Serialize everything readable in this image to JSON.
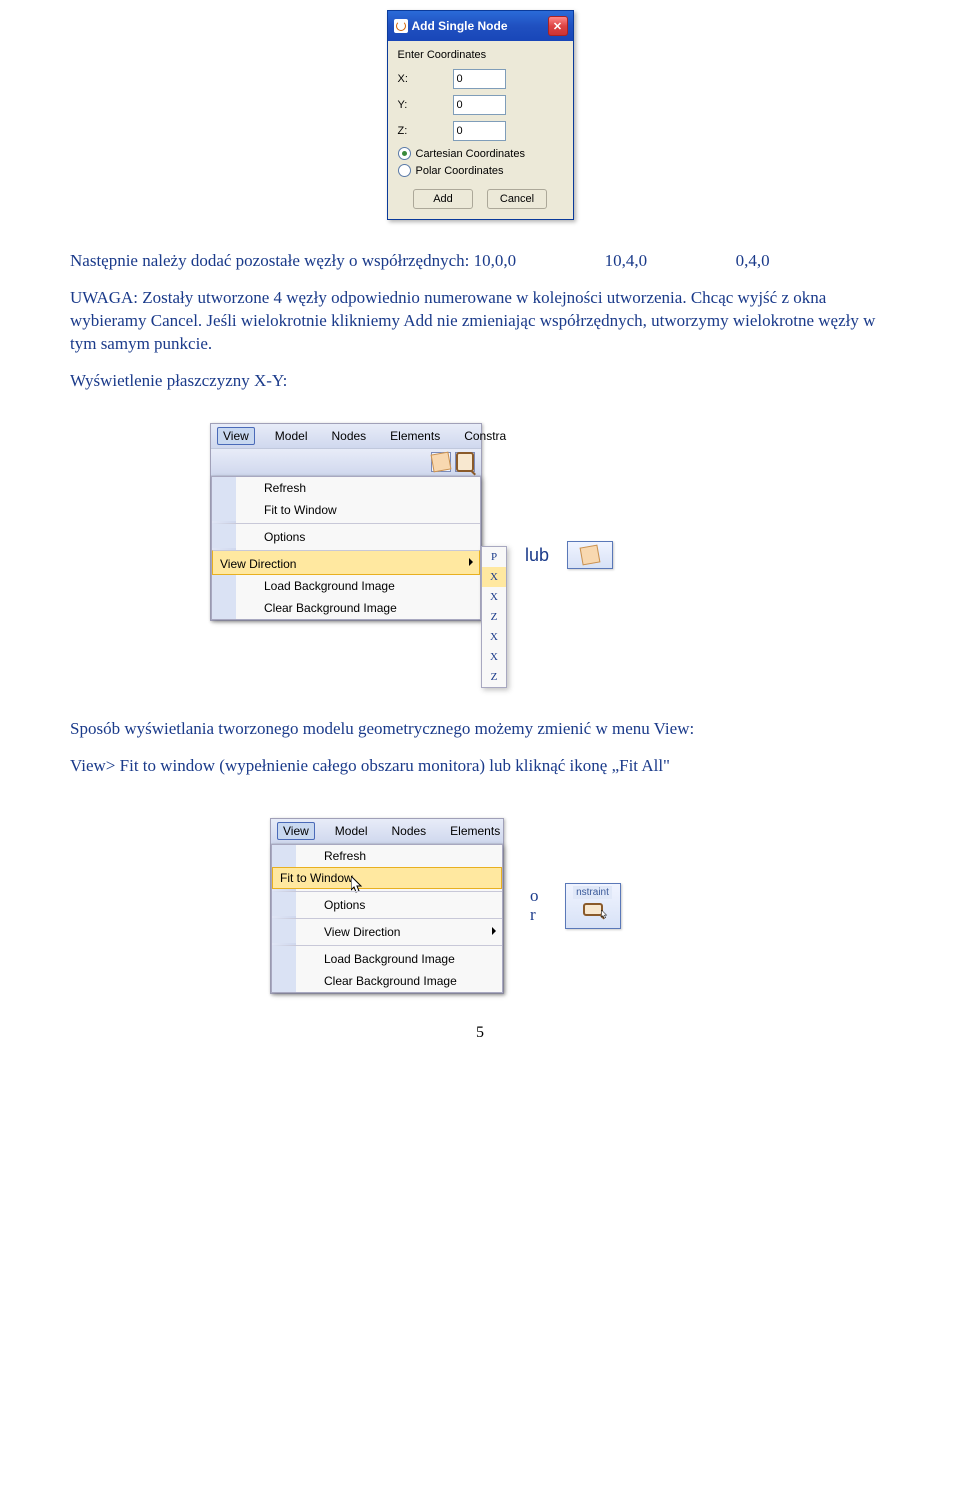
{
  "dialog": {
    "title": "Add Single Node",
    "enter_label": "Enter Coordinates",
    "x_label": "X:",
    "y_label": "Y:",
    "z_label": "Z:",
    "x_value": "0",
    "y_value": "0",
    "z_value": "0",
    "cartesian_label": "Cartesian Coordinates",
    "polar_label": "Polar Coordinates",
    "add_btn": "Add",
    "cancel_btn": "Cancel"
  },
  "text": {
    "line1_a": "Następnie należy dodać pozostałe węzły o współrzędnych: 10,0,0",
    "line1_b": "10,4,0",
    "line1_c": "0,4,0",
    "para2": "UWAGA: Zostały utworzone 4 węzły odpowiednio numerowane w kolejności utworzenia. Chcąc wyjść z okna wybieramy Cancel. Jeśli wielokrotnie klikniemy Add nie zmieniając współrzędnych, utworzymy wielokrotne węzły w tym samym  punkcie.",
    "para3": "Wyświetlenie płaszczyzny X-Y:",
    "lub": "lub",
    "para4": " Sposób wyświetlania tworzonego modelu geometrycznego możemy zmienić w menu View:",
    "para5": "View> Fit to window (wypełnienie całego obszaru monitora) lub kliknąć ikonę „Fit All\"",
    "or_1": "o",
    "or_2": "r",
    "page_num": "5"
  },
  "menu1": {
    "bar": [
      "View",
      "Model",
      "Nodes",
      "Elements",
      "Constra"
    ],
    "items": {
      "refresh": "Refresh",
      "fit": "Fit to Window",
      "options": "Options",
      "viewdir": "View Direction",
      "loadbg": "Load Background Image",
      "clearbg": "Clear Background Image"
    },
    "submenu_letters": [
      "P",
      "X",
      "X",
      "Z",
      "X",
      "X",
      "Z"
    ]
  },
  "menu2": {
    "bar": [
      "View",
      "Model",
      "Nodes",
      "Elements"
    ],
    "items": {
      "refresh": "Refresh",
      "fit": "Fit to Window",
      "options": "Options",
      "viewdir": "View Direction",
      "loadbg": "Load Background Image",
      "clearbg": "Clear Background Image"
    },
    "nstraint": "nstraint"
  }
}
